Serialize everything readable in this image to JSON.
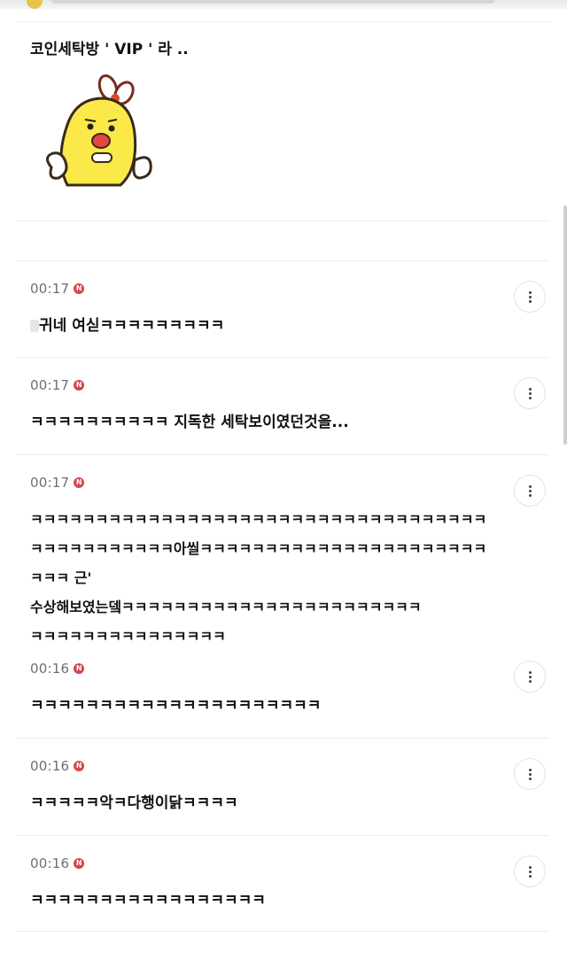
{
  "comments": [
    {
      "time": "",
      "badge": "",
      "text": "코인세탁방 ' VIP ' 라 ..",
      "sticker": "chick-sticker"
    },
    {
      "time": "00:17",
      "badge": "N",
      "text": "귀네 여싣ㅋㅋㅋㅋㅋㅋㅋㅋㅋ"
    },
    {
      "time": "00:17",
      "badge": "N",
      "text": "ㅋㅋㅋㅋㅋㅋㅋㅋㅋㅋ 지독한 세탁보이였던것을..."
    },
    {
      "time": "00:17",
      "badge": "N",
      "text": "ㅋㅋㅋㅋㅋㅋㅋㅋㅋㅋㅋㅋㅋㅋㅋㅋㅋㅋㅋㅋㅋㅋㅋㅋㅋㅋㅋㅋㅋㅋㅋㅋㅋㅋㅋ\nㅋㅋㅋㅋㅋㅋㅋㅋㅋㅋㅋ아씰ㅋㅋㅋㅋㅋㅋㅋㅋㅋㅋㅋㅋㅋㅋㅋㅋㅋㅋㅋㅋㅋㅋ\nㅋㅋㅋ 근'\n수상해보였는뎈ㅋㅋㅋㅋㅋㅋㅋㅋㅋㅋㅋㅋㅋㅋㅋㅋㅋㅋㅋㅋㅋㅋㅋ\nㅋㅋㅋㅋㅋㅋㅋㅋㅋㅋㅋㅋㅋㅋㅋ"
    },
    {
      "time": "00:16",
      "badge": "N",
      "text": "ㅋㅋㅋㅋㅋㅋㅋㅋㅋㅋㅋㅋㅋㅋㅋㅋㅋㅋㅋㅋㅋ"
    },
    {
      "time": "00:16",
      "badge": "N",
      "text": "ㅋㅋㅋㅋㅋ악ㅋ다행이닭ㅋㅋㅋㅋ"
    },
    {
      "time": "00:16",
      "badge": "N",
      "text": "ㅋㅋㅋㅋㅋㅋㅋㅋㅋㅋㅋㅋㅋㅋㅋㅋㅋ"
    }
  ],
  "icons": {
    "more": "more-vertical-icon",
    "badge": "new-badge-icon"
  },
  "colors": {
    "badge": "#d6454a",
    "time": "#6f6f6f",
    "divider": "#ececec"
  }
}
